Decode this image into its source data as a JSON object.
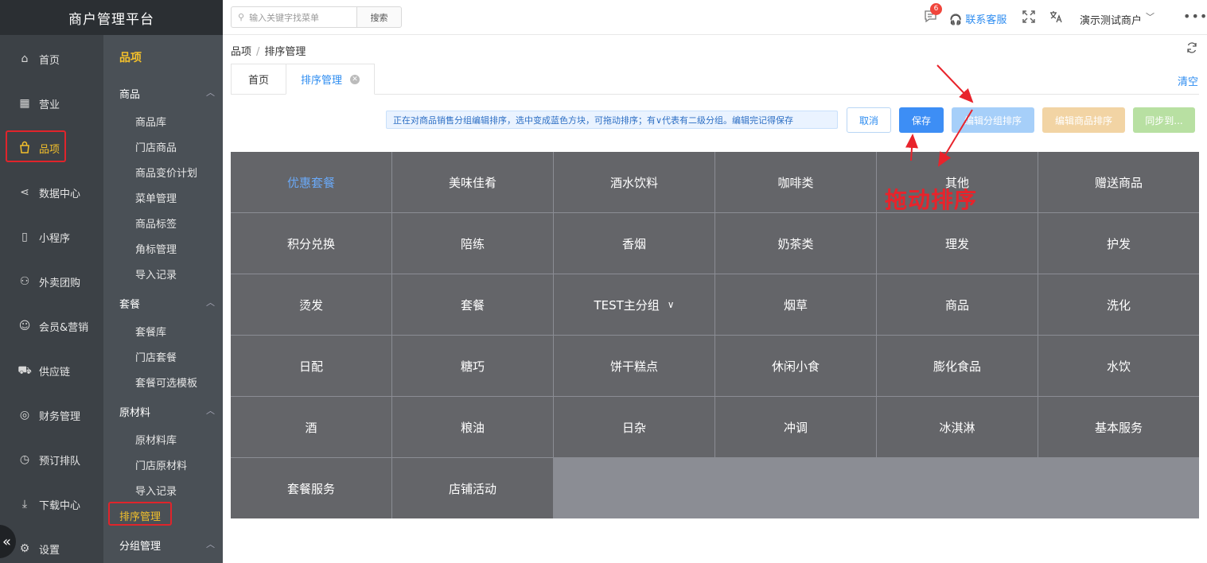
{
  "app": {
    "title": "商户管理平台"
  },
  "sidebar": {
    "items": [
      {
        "label": "首页",
        "icon": "home-icon"
      },
      {
        "label": "营业",
        "icon": "calendar-icon"
      },
      {
        "label": "品项",
        "icon": "bag-icon",
        "active": true
      },
      {
        "label": "数据中心",
        "icon": "share-icon"
      },
      {
        "label": "小程序",
        "icon": "phone-icon"
      },
      {
        "label": "外卖团购",
        "icon": "bike-icon"
      },
      {
        "label": "会员&营销",
        "icon": "user-icon"
      },
      {
        "label": "供应链",
        "icon": "truck-icon"
      },
      {
        "label": "财务管理",
        "icon": "coins-icon"
      },
      {
        "label": "预订排队",
        "icon": "clock-icon"
      },
      {
        "label": "下载中心",
        "icon": "download-icon"
      },
      {
        "label": "设置",
        "icon": "gear-icon"
      }
    ],
    "collapse_glyph": "«"
  },
  "subnav": {
    "title": "品项",
    "groups": [
      {
        "label": "商品",
        "items": [
          "商品库",
          "门店商品",
          "商品变价计划",
          "菜单管理",
          "商品标签",
          "角标管理",
          "导入记录"
        ]
      },
      {
        "label": "套餐",
        "items": [
          "套餐库",
          "门店套餐",
          "套餐可选模板"
        ]
      },
      {
        "label": "原材料",
        "items": [
          "原材料库",
          "门店原材料",
          "导入记录"
        ]
      }
    ],
    "active_item": "排序管理",
    "last_group": "分组管理"
  },
  "header": {
    "search_placeholder": "输入关键字找菜单",
    "search_button": "搜索",
    "message_count": "6",
    "support_label": "联系客服",
    "merchant_name": "演示测试商户",
    "more_glyph": "•••"
  },
  "breadcrumb": {
    "parent": "品项",
    "sep": "/",
    "current": "排序管理"
  },
  "tabs": [
    {
      "label": "首页"
    },
    {
      "label": "排序管理",
      "active": true
    }
  ],
  "clear_label": "清空",
  "toolbar": {
    "hint": "正在对商品销售分组编辑排序，选中变成蓝色方块，可拖动排序；有∨代表有二级分组。编辑完记得保存",
    "cancel": "取消",
    "save": "保存",
    "edit_group_sort": "编辑分组排序",
    "edit_item_sort": "编辑商品排序",
    "sync": "同步到..."
  },
  "groups": [
    "优惠套餐",
    "美味佳肴",
    "酒水饮料",
    "咖啡类",
    "其他",
    "赠送商品",
    "积分兑换",
    "陪练",
    "香烟",
    "奶茶类",
    "理发",
    "护发",
    "烫发",
    "套餐",
    "TEST主分组",
    "烟草",
    "商品",
    "洗化",
    "日配",
    "糖巧",
    "饼干糕点",
    "休闲小食",
    "膨化食品",
    "水饮",
    "酒",
    "粮油",
    "日杂",
    "冲调",
    "冰淇淋",
    "基本服务",
    "套餐服务",
    "店铺活动"
  ],
  "annotation": {
    "drag_note": "拖动排序"
  }
}
